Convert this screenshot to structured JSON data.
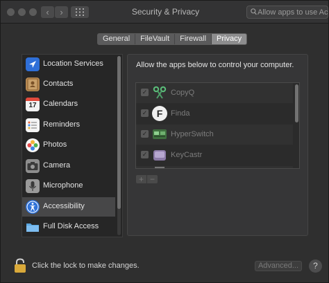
{
  "window": {
    "title": "Security & Privacy"
  },
  "toolbar": {
    "back_glyph": "‹",
    "forward_glyph": "›",
    "search_placeholder": "Allow apps to use Ac"
  },
  "tabs": [
    {
      "label": "General",
      "active": false
    },
    {
      "label": "FileVault",
      "active": false
    },
    {
      "label": "Firewall",
      "active": false
    },
    {
      "label": "Privacy",
      "active": true
    }
  ],
  "sidebar": {
    "items": [
      {
        "label": "Location Services",
        "icon": "location-arrow-icon",
        "selected": false
      },
      {
        "label": "Contacts",
        "icon": "contacts-book-icon",
        "selected": false
      },
      {
        "label": "Calendars",
        "icon": "calendar-icon",
        "selected": false,
        "day": "17"
      },
      {
        "label": "Reminders",
        "icon": "reminders-list-icon",
        "selected": false
      },
      {
        "label": "Photos",
        "icon": "photos-flower-icon",
        "selected": false
      },
      {
        "label": "Camera",
        "icon": "camera-icon",
        "selected": false
      },
      {
        "label": "Microphone",
        "icon": "microphone-icon",
        "selected": false
      },
      {
        "label": "Accessibility",
        "icon": "accessibility-person-icon",
        "selected": true
      },
      {
        "label": "Full Disk Access",
        "icon": "folder-icon",
        "selected": false
      }
    ]
  },
  "privacy": {
    "description": "Allow the apps below to control your computer.",
    "apps": [
      {
        "name": "CopyQ",
        "checked": true,
        "icon": "scissors-icon"
      },
      {
        "name": "Finda",
        "checked": true,
        "icon": "finda-f-icon",
        "icon_letter": "F"
      },
      {
        "name": "HyperSwitch",
        "checked": true,
        "icon": "hyperswitch-icon"
      },
      {
        "name": "KeyCastr",
        "checked": true,
        "icon": "keycastr-icon"
      }
    ],
    "add_label": "+",
    "remove_label": "−"
  },
  "footer": {
    "lock_text": "Click the lock to make changes.",
    "advanced_label": "Advanced...",
    "help_label": "?"
  },
  "colors": {
    "window_bg": "#2f2f2f",
    "selected_row": "#474748",
    "active_tab": "#8d8d8e",
    "lock_gold": "#d9a93a"
  }
}
